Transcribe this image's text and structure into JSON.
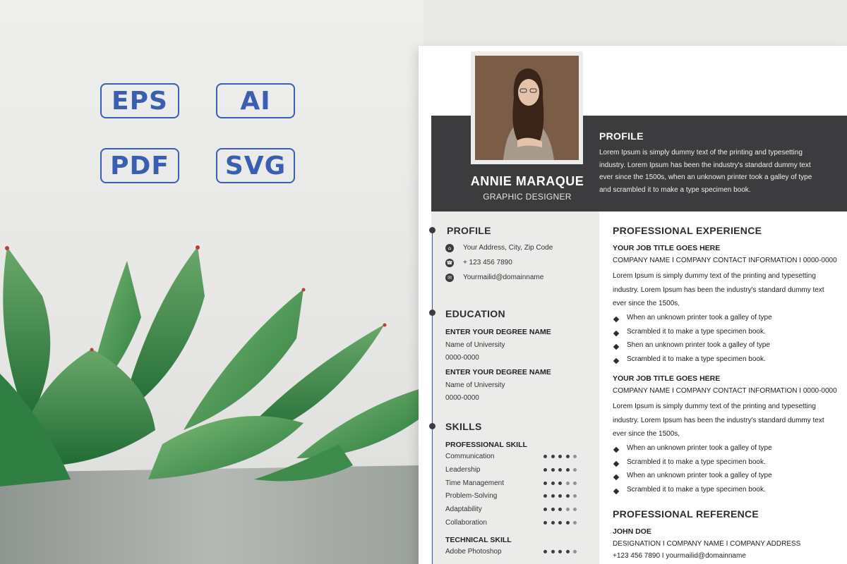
{
  "badges": [
    "EPS",
    "AI",
    "PDF",
    "SVG"
  ],
  "header": {
    "name": "ANNIE MARAQUE",
    "role": "GRAPHIC DESIGNER",
    "profile_title": "PROFILE",
    "profile_text": "Lorem Ipsum is simply dummy text of the printing and typesetting industry. Lorem Ipsum has been the industry's standard dummy text ever since the 1500s, when an unknown printer took a galley of type and scrambled it to make a type specimen book."
  },
  "sidebar": {
    "profile": {
      "title": "PROFILE",
      "address": "Your Address, City, Zip Code",
      "phone": "+ 123 456 7890",
      "email": "Yourmailid@domainname"
    },
    "education": {
      "title": "EDUCATION",
      "entries": [
        {
          "degree": "ENTER YOUR DEGREE NAME",
          "university": "Name of University",
          "years": "0000-0000"
        },
        {
          "degree": "ENTER YOUR DEGREE NAME",
          "university": "Name of University",
          "years": "0000-0000"
        }
      ]
    },
    "skills": {
      "title": "SKILLS",
      "professional_title": "PROFESSIONAL SKILL",
      "professional": [
        {
          "name": "Communication",
          "level": 4
        },
        {
          "name": "Leadership",
          "level": 4
        },
        {
          "name": "Time Management",
          "level": 3
        },
        {
          "name": "Problem-Solving",
          "level": 4
        },
        {
          "name": "Adaptability",
          "level": 3
        },
        {
          "name": "Collaboration",
          "level": 4
        }
      ],
      "technical_title": "TECHNICAL SKILL",
      "technical": [
        {
          "name": "Adobe Photoshop",
          "level": 4
        }
      ]
    }
  },
  "experience": {
    "title": "PROFESSIONAL EXPERIENCE",
    "jobs": [
      {
        "title": "YOUR JOB TITLE GOES HERE",
        "company": "COMPANY NAME I COMPANY CONTACT INFORMATION I 0000-0000",
        "desc": "Lorem Ipsum is simply dummy text of the printing and typesetting industry. Lorem Ipsum has been the industry's standard dummy text ever since the 1500s,",
        "bullets": [
          "When an unknown printer took a galley of type",
          "Scrambled it to make a type specimen book.",
          "Shen an unknown printer took a galley of type",
          "Scrambled it to make a type specimen book."
        ]
      },
      {
        "title": "YOUR JOB TITLE GOES HERE",
        "company": "COMPANY NAME I COMPANY CONTACT INFORMATION I 0000-0000",
        "desc": "Lorem Ipsum is simply dummy text of the printing and typesetting industry. Lorem Ipsum has been the industry's standard dummy text ever since the 1500s,",
        "bullets": [
          "When an unknown printer took a galley of type",
          "Scrambled it to make a type specimen book.",
          "When an unknown printer took a galley of type",
          "Scrambled it to make a type specimen book."
        ]
      }
    ]
  },
  "reference": {
    "title": "PROFESSIONAL REFERENCE",
    "name": "JOHN DOE",
    "line1": "DESIGNATION I COMPANY NAME I COMPANY ADDRESS",
    "line2": "+123 456 7890 I yourmailid@domainname"
  },
  "colors": {
    "badge_blue": "#3a5fb0",
    "header_dark": "#3c3c3e",
    "timeline_blue": "#3b5fae",
    "sidebar_bg": "#ebebe9"
  }
}
